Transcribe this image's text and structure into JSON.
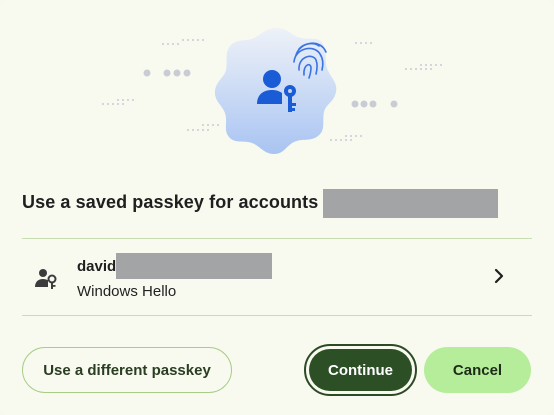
{
  "dialog": {
    "title": "Use a saved passkey for accounts",
    "icons": {
      "hero": "passkey-user-key-icon",
      "fingerprint": "fingerprint-icon",
      "account": "person-key-icon",
      "chevron": "chevron-right-icon"
    },
    "colors": {
      "primary": "#2d4f26",
      "cancel_bg": "#b6ed9b",
      "divider": "#c9ddb2",
      "accent_blue": "#1a5bd6"
    }
  },
  "account": {
    "name": "david",
    "method": "Windows Hello"
  },
  "buttons": {
    "different": "Use a different passkey",
    "continue": "Continue",
    "cancel": "Cancel"
  }
}
